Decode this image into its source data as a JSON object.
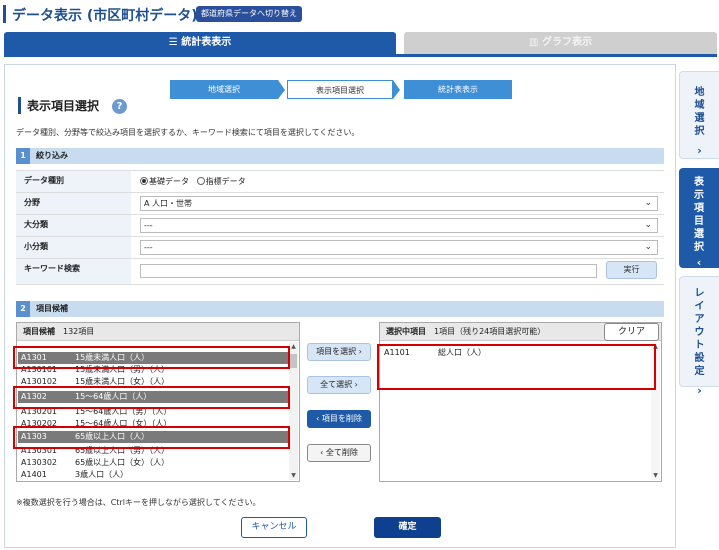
{
  "header": {
    "title": "データ表示 (市区町村データ)",
    "switch_label": "都道府県データへ切り替え"
  },
  "main_tabs": {
    "stats_table": "☰ 統計表表示",
    "graph": "グラフ表示"
  },
  "steps": [
    "地域選択",
    "表示項目選択",
    "統計表表示"
  ],
  "section": {
    "title": "表示項目選択",
    "help": "?",
    "description": "データ種別、分野等で絞込み項目を選択するか、キーワード検索にて項目を選択してください。"
  },
  "filter": {
    "num": "1",
    "heading": "絞り込み",
    "data_type_label": "データ種別",
    "data_type_options": [
      "基礎データ",
      "指標データ"
    ],
    "field_label": "分野",
    "field_value": "A 人口・世帯",
    "major_label": "大分類",
    "major_value": "---",
    "minor_label": "小分類",
    "minor_value": "---",
    "keyword_label": "キーワード検索",
    "exec_label": "実行"
  },
  "candidates": {
    "num": "2",
    "heading": "項目候補",
    "panel_title": "項目候補",
    "count": "132項目",
    "items": [
      {
        "code": "A1301",
        "name": "15歳未満人口（人）",
        "selected": true
      },
      {
        "code": "A130101",
        "name": "15歳未満人口（男）（人）",
        "selected": false
      },
      {
        "code": "A130102",
        "name": "15歳未満人口（女）（人）",
        "selected": false
      },
      {
        "code": "A1302",
        "name": "15～64歳人口（人）",
        "selected": true
      },
      {
        "code": "A130201",
        "name": "15～64歳人口（男）（人）",
        "selected": false
      },
      {
        "code": "A130202",
        "name": "15～64歳人口（女）（人）",
        "selected": false
      },
      {
        "code": "A1303",
        "name": "65歳以上人口（人）",
        "selected": true
      },
      {
        "code": "A130301",
        "name": "65歳以上人口（男）（人）",
        "selected": false
      },
      {
        "code": "A130302",
        "name": "65歳以上人口（女）（人）",
        "selected": false
      },
      {
        "code": "A1401",
        "name": "3歳人口（人）",
        "selected": false
      }
    ]
  },
  "buttons": {
    "select_item": "項目を選択 ›",
    "select_all": "全て選択 ›",
    "remove_item": "‹ 項目を削除",
    "remove_all": "‹ 全て削除",
    "clear": "クリア",
    "cancel": "キャンセル",
    "confirm": "確定"
  },
  "selected_panel": {
    "title": "選択中項目",
    "info": "1項目（残り24項目選択可能）",
    "items": [
      {
        "code": "A1101",
        "name": "総人口（人）"
      }
    ]
  },
  "note": "※複数選択を行う場合は、Ctrlキーを押しながら選択してください。",
  "side_tabs": {
    "region": "地域選択",
    "items": "表示項目選択",
    "layout": "レイアウト設定"
  },
  "colors": {
    "primary": "#1f5aa8",
    "highlight": "#d40000",
    "selected_row": "#7a7a7a"
  }
}
